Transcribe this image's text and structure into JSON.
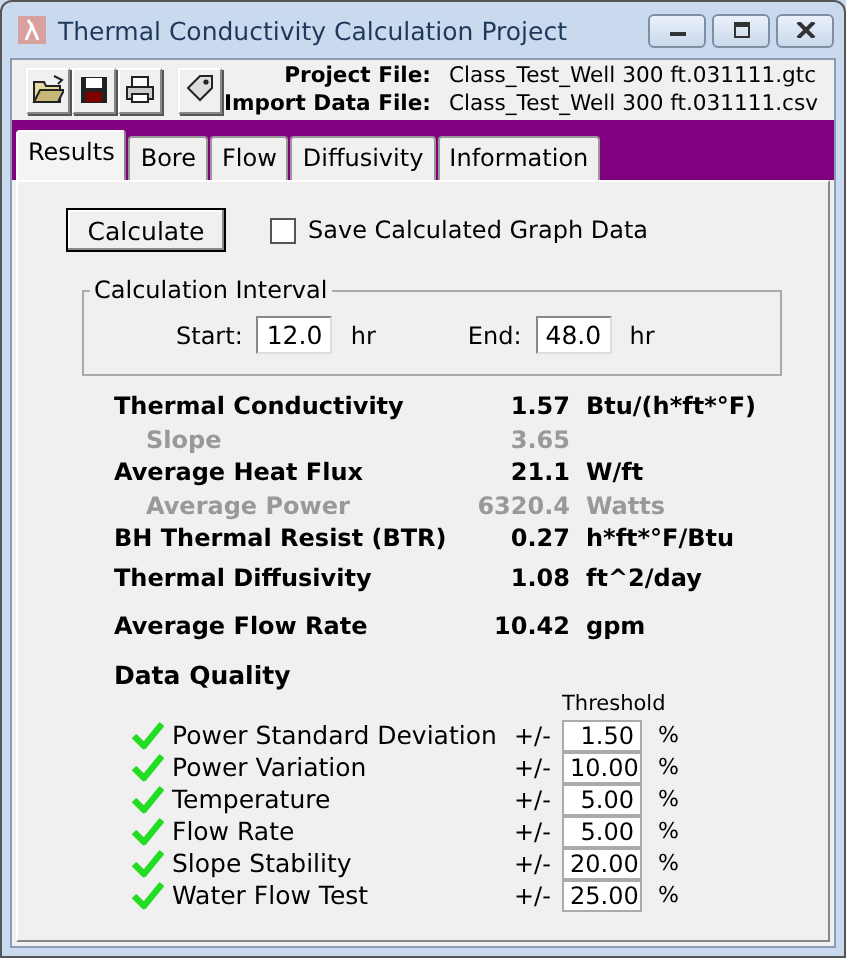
{
  "window": {
    "title": "Thermal Conductivity Calculation Project"
  },
  "files": [
    {
      "label": "Project File:",
      "value": "Class_Test_Well 300 ft.031111.gtc"
    },
    {
      "label": "Import Data File:",
      "value": "Class_Test_Well 300 ft.031111.csv"
    }
  ],
  "tabs": [
    {
      "label": "Results",
      "selected": true
    },
    {
      "label": "Bore",
      "selected": false
    },
    {
      "label": "Flow",
      "selected": false
    },
    {
      "label": "Diffusivity",
      "selected": false
    },
    {
      "label": "Information",
      "selected": false
    }
  ],
  "calculate_button": "Calculate",
  "save_graph_data": {
    "label": "Save Calculated Graph Data",
    "checked": false
  },
  "interval": {
    "title": "Calculation Interval",
    "start_label": "Start:",
    "start": "12.0",
    "start_unit": "hr",
    "end_label": "End:",
    "end": "48.0",
    "end_unit": "hr"
  },
  "results": [
    {
      "kind": "primary",
      "label": "Thermal Conductivity",
      "value": "1.57",
      "unit": "Btu/(h*ft*°F)"
    },
    {
      "kind": "secondary",
      "label": "Slope",
      "value": "3.65"
    },
    {
      "kind": "primary",
      "label": "Average Heat Flux",
      "value": "21.1",
      "unit": "W/ft"
    },
    {
      "kind": "secondary",
      "label": "Average Power",
      "value": "6320.4",
      "unit": "Watts"
    },
    {
      "kind": "primary",
      "label": "BH Thermal Resist (BTR)",
      "value": "0.27",
      "unit": "h*ft*°F/Btu"
    },
    {
      "kind": "primary",
      "label": "Thermal Diffusivity",
      "value": "1.08",
      "unit": "ft^2/day"
    },
    {
      "kind": "primary",
      "label": "Average Flow Rate",
      "value": "10.42",
      "unit": "gpm"
    }
  ],
  "data_quality": {
    "title": "Data Quality",
    "threshold_header": "Threshold",
    "items": [
      {
        "label": "Power Standard Deviation",
        "passed": true,
        "sign": "+/-",
        "threshold": "1.50",
        "unit": "%"
      },
      {
        "label": "Power Variation",
        "passed": true,
        "sign": "+/-",
        "threshold": "10.00",
        "unit": "%"
      },
      {
        "label": "Temperature",
        "passed": true,
        "sign": "+/-",
        "threshold": "5.00",
        "unit": "%"
      },
      {
        "label": "Flow Rate",
        "passed": true,
        "sign": "+/-",
        "threshold": "5.00",
        "unit": "%"
      },
      {
        "label": "Slope Stability",
        "passed": true,
        "sign": "+/-",
        "threshold": "20.00",
        "unit": "%"
      },
      {
        "label": "Water Flow Test",
        "passed": true,
        "sign": "+/-",
        "threshold": "25.00",
        "unit": "%"
      }
    ]
  }
}
